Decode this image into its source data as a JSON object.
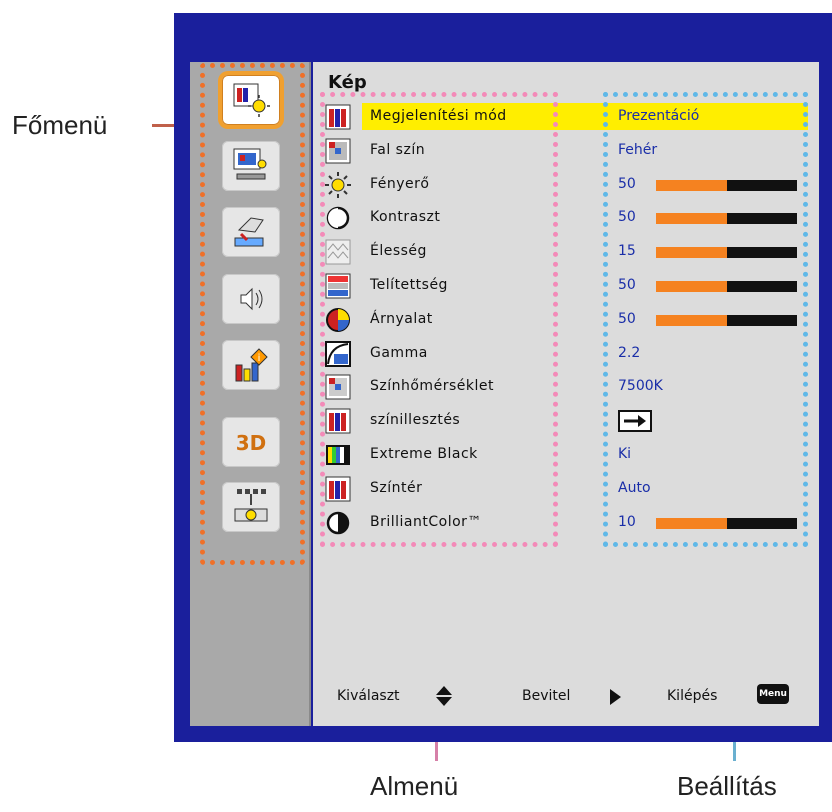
{
  "callouts": {
    "main_menu": "Főmenü",
    "submenu": "Almenü",
    "settings": "Beállítás"
  },
  "osd": {
    "title": "Kép",
    "main_menu_icons": [
      "picture-icon",
      "display-icon",
      "setup-icon",
      "audio-icon",
      "options-icon",
      "3d-icon",
      "lan-icon"
    ],
    "main_menu_3d_label": "3D",
    "rows": [
      {
        "label": "Megjelenítési mód",
        "value": "Prezentáció",
        "icon": "display-mode-icon",
        "selected": true
      },
      {
        "label": "Fal szín",
        "value": "Fehér",
        "icon": "wall-color-icon"
      },
      {
        "label": "Fényerő",
        "value": "50",
        "icon": "brightness-icon",
        "level": 0.5
      },
      {
        "label": "Kontraszt",
        "value": "50",
        "icon": "contrast-icon",
        "level": 0.5
      },
      {
        "label": "Élesség",
        "value": "15",
        "icon": "sharpness-icon",
        "level": 0.5
      },
      {
        "label": "Telítettség",
        "value": "50",
        "icon": "saturation-icon",
        "level": 0.5
      },
      {
        "label": "Árnyalat",
        "value": "50",
        "icon": "tint-icon",
        "level": 0.5
      },
      {
        "label": "Gamma",
        "value": "2.2",
        "icon": "gamma-icon"
      },
      {
        "label": "Színhőmérséklet",
        "value": "7500K",
        "icon": "color-temp-icon"
      },
      {
        "label": "színillesztés",
        "value": "",
        "icon": "color-matching-icon",
        "arrow": true
      },
      {
        "label": "Extreme Black",
        "value": "Ki",
        "icon": "extreme-black-icon"
      },
      {
        "label": "Színtér",
        "value": "Auto",
        "icon": "color-space-icon"
      },
      {
        "label": "BrilliantColor™",
        "value": "10",
        "icon": "brilliantcolor-icon",
        "level": 0.5
      }
    ],
    "hints": {
      "select": "Kiválaszt",
      "enter": "Bevitel",
      "exit": "Kilépés",
      "menu_key": "Menu"
    }
  },
  "colors": {
    "frame": "#1a1f9c",
    "highlight": "#ffee00",
    "value_text": "#1a2ea8",
    "bar_fill": "#f58220",
    "main_menu_outline": "#f07028",
    "submenu_outline": "#f38ab8",
    "settings_outline": "#5fb8e8"
  }
}
